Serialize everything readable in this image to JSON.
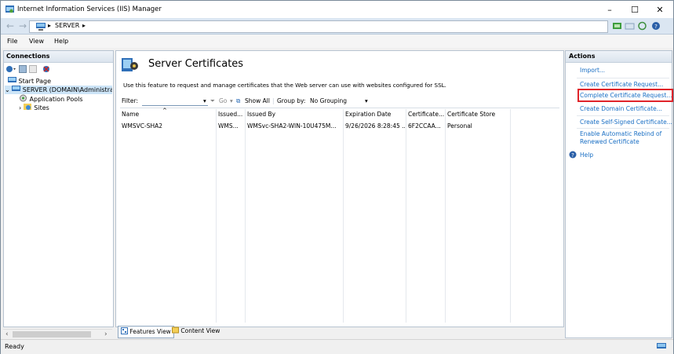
{
  "window": {
    "title": "Internet Information Services (IIS) Manager",
    "controls": {
      "minimize": "–",
      "maximize": "☐",
      "close": "✕"
    }
  },
  "address": {
    "back": "←",
    "forward": "→",
    "breadcrumb": [
      "SERVER"
    ],
    "separator": "▸"
  },
  "menu": [
    "File",
    "View",
    "Help"
  ],
  "connections": {
    "title": "Connections",
    "tree": [
      {
        "label": "Start Page"
      },
      {
        "label": "SERVER (DOMAIN\\Administra"
      },
      {
        "label": "Application Pools"
      },
      {
        "label": "Sites"
      }
    ]
  },
  "page": {
    "title": "Server Certificates",
    "description": "Use this feature to request and manage certificates that the Web server can use with websites configured for SSL.",
    "filter_label": "Filter:",
    "go_label": "Go",
    "show_all_label": "Show All",
    "group_by_label": "Group by:",
    "group_by_value": "No Grouping",
    "columns": [
      "Name",
      "Issued...",
      "Issued By",
      "Expiration Date",
      "Certificate...",
      "Certificate Store"
    ],
    "rows": [
      [
        "WMSVC-SHA2",
        "WMS...",
        "WMSvc-SHA2-WIN-10U475M...",
        "9/26/2026 8:28:45 ...",
        "6F2CCAA...",
        "Personal"
      ]
    ]
  },
  "bottom_tabs": {
    "features_view": "Features View",
    "content_view": "Content View"
  },
  "actions": {
    "title": "Actions",
    "items": [
      {
        "label": "Import..."
      },
      {
        "label": "Create Certificate Request..."
      },
      {
        "label": "Complete Certificate Request...",
        "highlighted": true
      },
      {
        "label": "Create Domain Certificate..."
      },
      {
        "label": "Create Self-Signed Certificate..."
      },
      {
        "label": "Enable Automatic Rebind of"
      },
      {
        "label": "Renewed Certificate"
      },
      {
        "label": "Help"
      }
    ]
  },
  "status": {
    "text": "Ready"
  },
  "colors": {
    "link": "#1a6fc4",
    "highlight_border": "#e0242a",
    "selection": "#cce4f7"
  }
}
